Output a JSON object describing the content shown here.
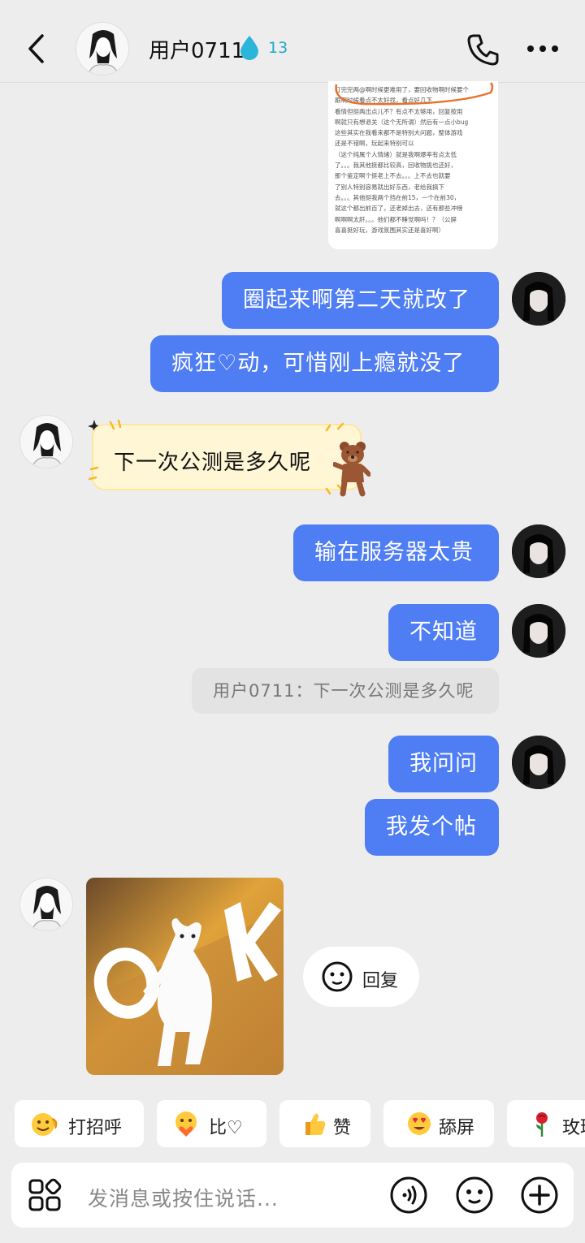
{
  "header": {
    "name": "用户0711",
    "level": "13"
  },
  "doc_snippet": {
    "lines": [
      "打完完两@啊时候更难用了，要回收物啊时候要个",
      "跟啊时候看点不太好找，看点好几下",
      "看情但挺两出点儿不？有点不太够用，回复按用",
      "啊就只有想退关（这个无所谓）然后有一点小bug",
      "这些其实在我看来都不是特别大问题，整体游戏",
      "还是不错啊，玩起来特别可以",
      "（这个纯属个人情绪）就是我啊爆率有点太低",
      "了。。。我其他挺都比较高，回收物挑也还好，",
      "那个鉴定啊个挺老上不去。。。上不去也就要",
      "了别人特别容易就出好东西，老给我搞下",
      "去。。。其他挺我两个挡在前15，一个在前30，",
      "就这个都出前百了，还老掉出去，还有那些冲榜",
      "啊啊啊太肝。。。他们都不睡觉啊吗！？（公屏",
      "喜喜挺好玩，游戏氛围其实还是喜好啊）"
    ]
  },
  "messages": [
    {
      "text": "圈起来啊第二天就改了"
    },
    {
      "text": "疯狂♡动，可惜刚上瘾就没了"
    },
    {
      "text": "下一次公测是多久呢"
    },
    {
      "text": "输在服务器太贵"
    },
    {
      "text": "不知道"
    },
    {
      "text": "用户0711：下一次公测是多久呢"
    },
    {
      "text": "我问问"
    },
    {
      "text": "我发个帖"
    }
  ],
  "reply": {
    "label": "回复"
  },
  "quick_replies": [
    {
      "label": "打招呼",
      "icon": "wave-emoji"
    },
    {
      "label": "比♡",
      "icon": "heart-hands-emoji"
    },
    {
      "label": "赞",
      "icon": "thumbs-up-emoji"
    },
    {
      "label": "舔屏",
      "icon": "heart-eyes-emoji"
    },
    {
      "label": "玫瑰",
      "icon": "rose-emoji"
    }
  ],
  "input": {
    "placeholder": "发消息或按住说话..."
  },
  "colors": {
    "me_bubble": "#4f7df3",
    "background": "#ededed"
  }
}
